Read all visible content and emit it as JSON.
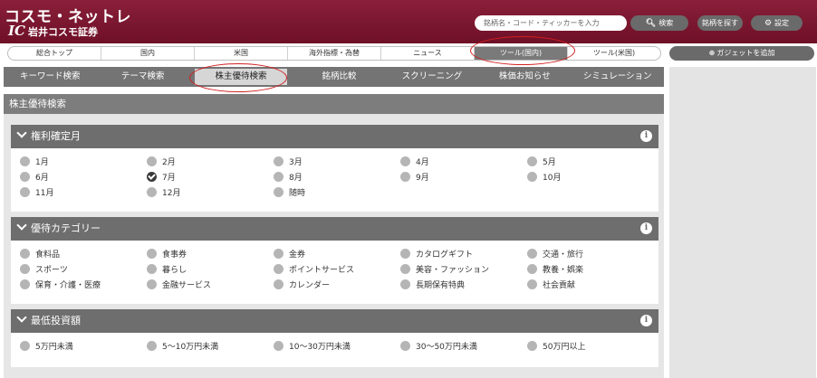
{
  "header": {
    "logo_main": "コスモ・ネットレ",
    "logo_sub_mark": "IC",
    "logo_sub": "岩井コスモ証券",
    "search_placeholder": "銘柄名・コード・ティッカーを入力",
    "search_button": "検索",
    "find_stock_button": "銘柄を探す",
    "settings_button": "設定"
  },
  "top_nav": {
    "items": [
      "総合トップ",
      "国内",
      "米国",
      "海外指標・為替",
      "ニュース",
      "ツール(国内)",
      "ツール(米国)"
    ],
    "active": "ツール(国内)"
  },
  "add_gadget": "ガジェットを追加",
  "sub_tabs": {
    "items": [
      "キーワード検索",
      "テーマ検索",
      "株主優待検索",
      "銘柄比較",
      "スクリーニング",
      "株価お知らせ",
      "シミュレーション"
    ],
    "active": "株主優待検索"
  },
  "page_title": "株主優待検索",
  "sections": [
    {
      "title": "権利確定月",
      "options": [
        "1月",
        "2月",
        "3月",
        "4月",
        "5月",
        "6月",
        "7月",
        "8月",
        "9月",
        "10月",
        "11月",
        "12月",
        "随時"
      ],
      "selected": [
        "7月"
      ]
    },
    {
      "title": "優待カテゴリー",
      "options": [
        "食料品",
        "食事券",
        "金券",
        "カタログギフト",
        "交通・旅行",
        "スポーツ",
        "暮らし",
        "ポイントサービス",
        "美容・ファッション",
        "教養・娯楽",
        "保育・介護・医療",
        "金融サービス",
        "カレンダー",
        "長期保有特典",
        "社会貢献"
      ],
      "selected": []
    },
    {
      "title": "最低投資額",
      "options": [
        "5万円未満",
        "5～10万円未満",
        "10～30万円未満",
        "30～50万円未満",
        "50万円以上"
      ],
      "selected": []
    }
  ],
  "colors": {
    "brand": "#7d1830",
    "annotation": "#d21f1f",
    "tab_bar": "#747474"
  }
}
